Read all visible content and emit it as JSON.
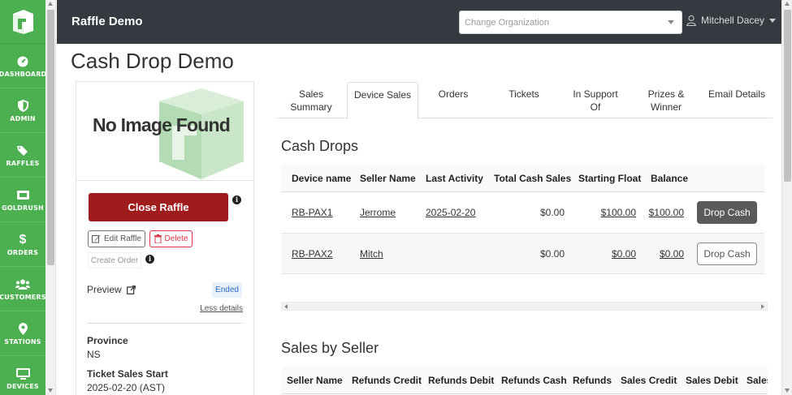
{
  "topbar": {
    "app_title": "Raffle Demo",
    "org_placeholder": "Change Organization",
    "user_name": "Mitchell Dacey"
  },
  "sidebar": {
    "items": [
      {
        "label": "DASHBOARD",
        "icon": "dashboard-icon"
      },
      {
        "label": "ADMIN",
        "icon": "shield-icon"
      },
      {
        "label": "RAFFLES",
        "icon": "tags-icon"
      },
      {
        "label": "GOLDRUSH",
        "icon": "ticket-icon"
      },
      {
        "label": "ORDERS",
        "icon": "dollar-icon"
      },
      {
        "label": "CUSTOMERS",
        "icon": "users-icon"
      },
      {
        "label": "STATIONS",
        "icon": "map-pin-icon"
      },
      {
        "label": "DEVICES",
        "icon": "monitor-icon"
      }
    ]
  },
  "page": {
    "title": "Cash Drop Demo"
  },
  "card": {
    "no_image_text": "No Image Found",
    "close_raffle": "Close Raffle",
    "edit_raffle": "Edit Raffle",
    "delete": "Delete",
    "create_order": "Create Order",
    "preview": "Preview",
    "status_badge": "Ended",
    "less_details": "Less details",
    "province_label": "Province",
    "province_value": "NS",
    "ticket_start_label": "Ticket Sales Start",
    "ticket_start_value": "2025-02-20 (AST)"
  },
  "tabs": [
    {
      "label": "Sales Summary"
    },
    {
      "label": "Device Sales"
    },
    {
      "label": "Orders"
    },
    {
      "label": "Tickets"
    },
    {
      "label": "In Support Of"
    },
    {
      "label": "Prizes & Winner"
    },
    {
      "label": "Email Details"
    }
  ],
  "cash_drops": {
    "title": "Cash Drops",
    "columns": [
      "Device name",
      "Seller Name",
      "Last Activity",
      "Total Cash Sales",
      "Starting Float",
      "Balance"
    ],
    "rows": [
      {
        "device": "RB-PAX1",
        "seller": "Jerrome",
        "last_activity": "2025-02-20",
        "total_cash": "$0.00",
        "starting_float": "$100.00",
        "balance": "$100.00",
        "action": "Drop Cash"
      },
      {
        "device": "RB-PAX2",
        "seller": "Mitch",
        "last_activity": "",
        "total_cash": "$0.00",
        "starting_float": "$0.00",
        "balance": "$0.00",
        "action": "Drop Cash"
      }
    ]
  },
  "sales_by_seller": {
    "title": "Sales by Seller",
    "columns": [
      "Seller Name",
      "Refunds Credit",
      "Refunds Debit",
      "Refunds Cash",
      "Refunds",
      "Sales Credit",
      "Sales Debit",
      "Sales"
    ]
  },
  "colors": {
    "sidebar_green": "#4caf50",
    "topbar": "#343a40",
    "close_red": "#a01c1c"
  }
}
